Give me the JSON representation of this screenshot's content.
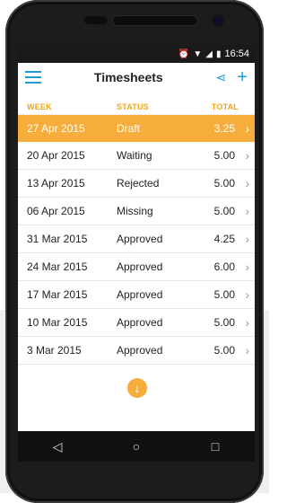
{
  "statusbar": {
    "time": "16:54",
    "icons": [
      "alarm-icon",
      "wifi-icon",
      "signal-icon",
      "battery-icon"
    ]
  },
  "appbar": {
    "title": "Timesheets",
    "menu_icon": "hamburger-icon",
    "share_icon": "share-icon",
    "add_icon": "plus-icon"
  },
  "table": {
    "headers": {
      "week": "WEEK",
      "status": "STATUS",
      "total": "TOTAL"
    },
    "rows": [
      {
        "week": "27 Apr 2015",
        "status": "Draft",
        "total": "3.25"
      },
      {
        "week": "20 Apr 2015",
        "status": "Waiting",
        "total": "5.00"
      },
      {
        "week": "13 Apr 2015",
        "status": "Rejected",
        "total": "5.00"
      },
      {
        "week": "06 Apr 2015",
        "status": "Missing",
        "total": "5.00"
      },
      {
        "week": "31 Mar 2015",
        "status": "Approved",
        "total": "4.25"
      },
      {
        "week": "24 Mar 2015",
        "status": "Approved",
        "total": "6.00"
      },
      {
        "week": "17 Mar 2015",
        "status": "Approved",
        "total": "5.00"
      },
      {
        "week": "10 Mar 2015",
        "status": "Approved",
        "total": "5.00"
      },
      {
        "week": "3 Mar 2015",
        "status": "Approved",
        "total": "5.00"
      }
    ]
  },
  "fab": {
    "icon": "arrow-down-icon"
  },
  "navbar": {
    "back_icon": "back-triangle-icon",
    "home_icon": "home-circle-icon",
    "recent_icon": "recent-square-icon"
  },
  "colors": {
    "accent": "#f7ad3b",
    "primary": "#1e9ad6"
  }
}
